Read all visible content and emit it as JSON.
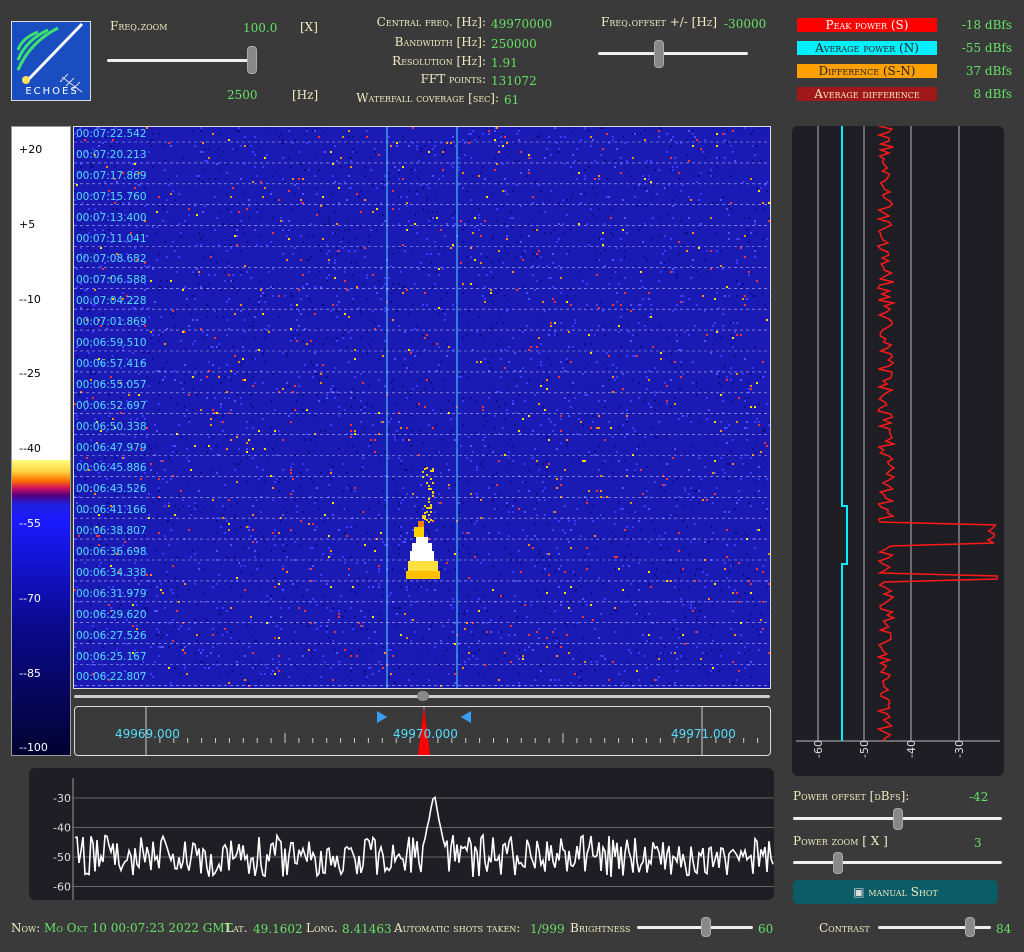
{
  "logo": {
    "text": "ECHOES"
  },
  "freq_zoom": {
    "label": "Freq.zoom",
    "value": "100.0",
    "unit": "[X]",
    "lower_value": "2500",
    "lower_unit": "[Hz]",
    "slider": 1.0
  },
  "info": {
    "central_freq": {
      "label": "Central freq. [Hz]:",
      "value": "49970000"
    },
    "bandwidth": {
      "label": "Bandwidth  [Hz]:",
      "value": "250000"
    },
    "resolution": {
      "label": "Resolution [Hz]:",
      "value": "1.91"
    },
    "fft_points": {
      "label": "FFT points:",
      "value": "131072"
    },
    "waterfall": {
      "label": "Waterfall coverage [sec]:",
      "value": "61"
    }
  },
  "freq_offset": {
    "label": "Freq.offset +/- [Hz]",
    "value": "-30000",
    "slider": 0.4
  },
  "legend": [
    {
      "label": "Peak power (S)",
      "value": "-18 dBfs",
      "bg": "#ff0000",
      "fg": "#ffffff"
    },
    {
      "label": "Average power (N)",
      "value": "-55 dBfs",
      "bg": "#00f0ff",
      "fg": "#222222"
    },
    {
      "label": "Difference (S-N)",
      "value": "37 dBfs",
      "bg": "#ffa000",
      "fg": "#222222"
    },
    {
      "label": "Average difference",
      "value": "8 dBfs",
      "bg": "#a01818",
      "fg": "#f0ebc0"
    }
  ],
  "color_scale": [
    "+20",
    "+5",
    "--10",
    "--25",
    "--40",
    "--55",
    "--70",
    "--85",
    "--100"
  ],
  "timestamps": [
    "00:07:22.542",
    "00:07:20.213",
    "00:07:17.869",
    "00:07:15.760",
    "00:07:13.400",
    "00:07:11.041",
    "00:07:08.682",
    "00:07:06.588",
    "00:07:04.228",
    "00:07:01.869",
    "00:06:59.510",
    "00:06:57.416",
    "00:06:55.057",
    "00:06:52.697",
    "00:06:50.338",
    "00:06:47.979",
    "00:06:45.886",
    "00:06:43.526",
    "00:06:41.166",
    "00:06:38.807",
    "00:06:36.698",
    "00:06:34.338",
    "00:06:31.979",
    "00:06:29.620",
    "00:06:27.526",
    "00:06:25.167",
    "00:06:22.807"
  ],
  "freq_axis": [
    "49969.000",
    "49970.000",
    "49971.000"
  ],
  "power_axis": [
    "-60",
    "-50",
    "-40",
    "-30"
  ],
  "spectrum_axis": [
    "-30",
    "-40",
    "-50",
    "-60"
  ],
  "power_offset": {
    "label": "Power offset [dBfs]:",
    "value": "-42",
    "slider": 0.5
  },
  "power_zoom": {
    "label": "Power zoom  [ X ]",
    "value": "3",
    "slider": 0.2
  },
  "manual_shot": {
    "label": "manual Shot"
  },
  "status": {
    "now_label": "Now:",
    "now_value": "Mo Okt 10 00:07:23 2022 GMT",
    "lat_label": "Lat.",
    "lat_value": "49.1602",
    "long_label": "Long.",
    "long_value": "8.41463",
    "shots_label": "Automatic shots taken:",
    "shots_value": "1/999",
    "brightness_label": "Brightness",
    "brightness_value": "60",
    "brightness_slider": 0.6,
    "contrast_label": "Contrast",
    "contrast_value": "84",
    "contrast_slider": 0.84
  },
  "colors": {
    "background": "#3a3a3a",
    "label": "#f0ebc0",
    "value": "#66e066",
    "waterfall_bg": "#1a1ab4",
    "trace": "#ff2020"
  }
}
